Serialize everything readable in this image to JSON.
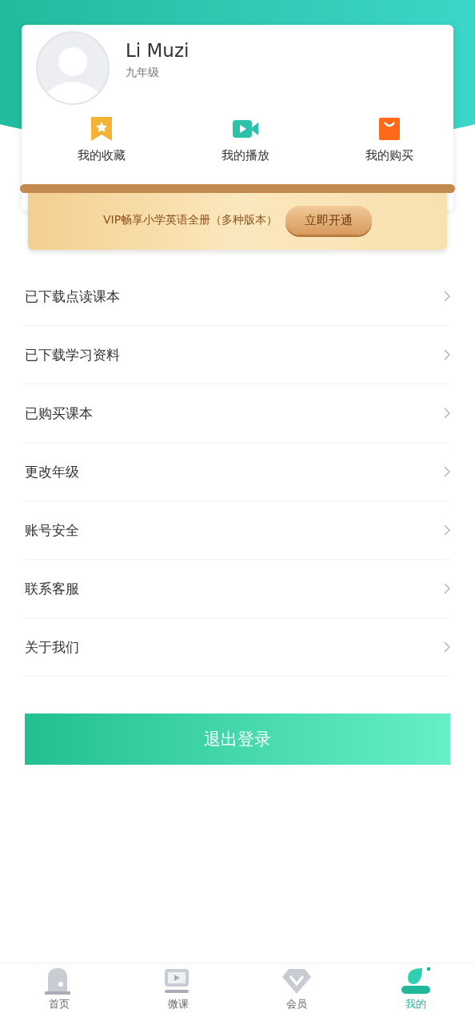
{
  "profile": {
    "name": "Li Muzi",
    "grade": "九年级"
  },
  "shortcuts": [
    {
      "kind": "favorites",
      "label": "我的收藏"
    },
    {
      "kind": "plays",
      "label": "我的播放"
    },
    {
      "kind": "purchases",
      "label": "我的购买"
    }
  ],
  "vip_banner": {
    "text": "VIP畅享小学英语全册（多种版本）",
    "button": "立即开通"
  },
  "menu": [
    {
      "label": "已下载点读课本"
    },
    {
      "label": "已下载学习资料"
    },
    {
      "label": "已购买课本"
    },
    {
      "label": "更改年级"
    },
    {
      "label": "账号安全"
    },
    {
      "label": "联系客服"
    },
    {
      "label": "关于我们"
    }
  ],
  "logout_button": "退出登录",
  "tabs": [
    {
      "kind": "home",
      "label": "首页",
      "selected": false
    },
    {
      "kind": "lessons",
      "label": "微课",
      "selected": false
    },
    {
      "kind": "vip",
      "label": "会员",
      "selected": false
    },
    {
      "kind": "me",
      "label": "我的",
      "selected": true
    }
  ]
}
